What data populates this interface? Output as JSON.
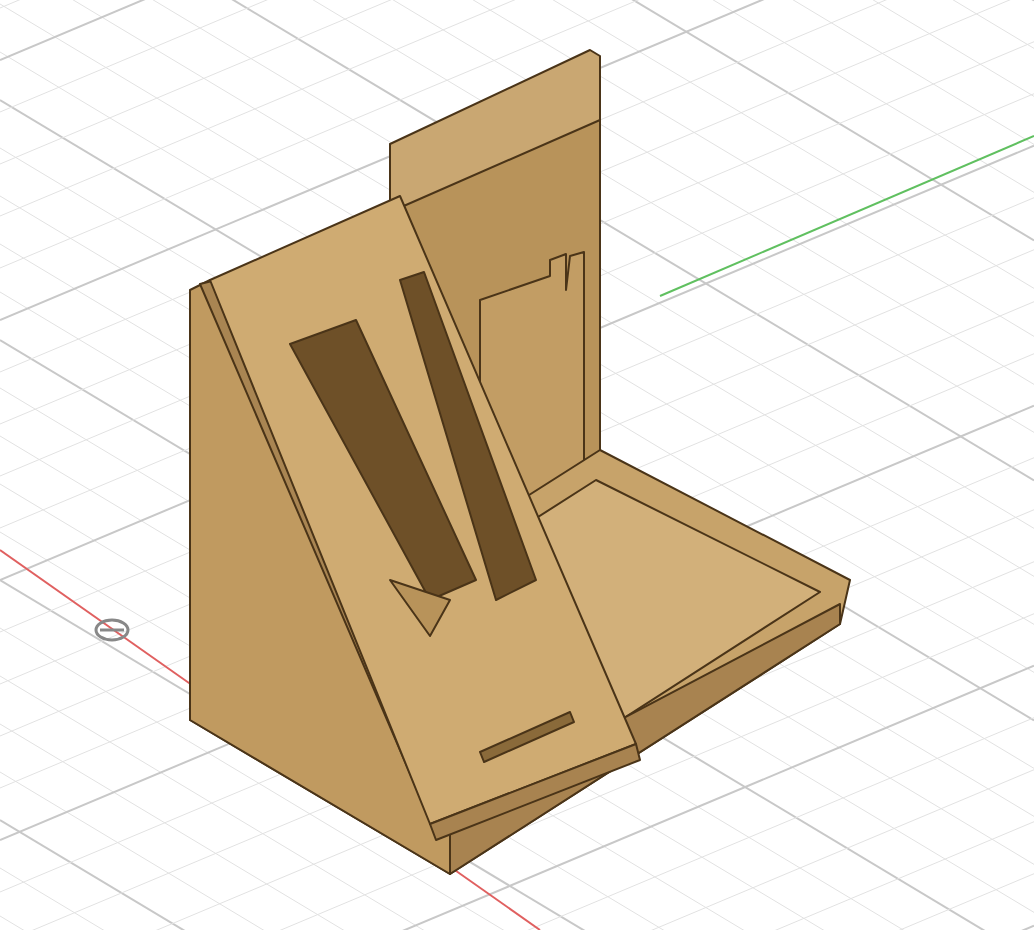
{
  "viewport": {
    "grid": true,
    "x_axis": true,
    "y_axis": true,
    "origin_marker": true
  }
}
